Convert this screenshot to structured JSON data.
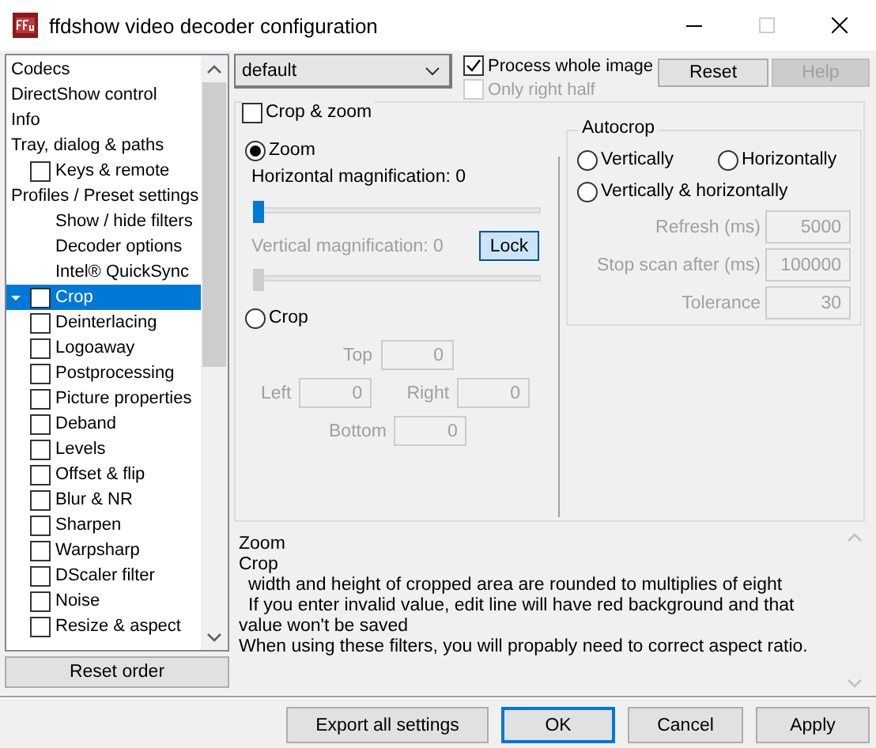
{
  "window": {
    "title": "ffdshow video decoder configuration"
  },
  "sidebar": {
    "items": [
      {
        "label": "Codecs",
        "selected": false
      },
      {
        "label": "DirectShow control",
        "selected": false
      },
      {
        "label": "Info",
        "selected": false
      },
      {
        "label": "Tray, dialog & paths",
        "selected": false,
        "children": [
          {
            "label": "Keys & remote",
            "kind": "checkbox",
            "checked": false,
            "selected": false
          }
        ]
      },
      {
        "label": "Profiles / Preset settings",
        "selected": false,
        "children": [
          {
            "label": "Show / hide filters",
            "kind": "plain",
            "selected": false
          },
          {
            "label": "Decoder options",
            "kind": "plain",
            "selected": false
          },
          {
            "label": "Intel® QuickSync",
            "kind": "plain",
            "selected": false
          },
          {
            "label": "Crop",
            "kind": "checkbox",
            "checked": false,
            "selected": true
          },
          {
            "label": "Deinterlacing",
            "kind": "checkbox",
            "checked": false,
            "selected": false
          },
          {
            "label": "Logoaway",
            "kind": "checkbox",
            "checked": false,
            "selected": false
          },
          {
            "label": "Postprocessing",
            "kind": "checkbox",
            "checked": false,
            "selected": false
          },
          {
            "label": "Picture properties",
            "kind": "checkbox",
            "checked": false,
            "selected": false
          },
          {
            "label": "Deband",
            "kind": "checkbox",
            "checked": false,
            "selected": false
          },
          {
            "label": "Levels",
            "kind": "checkbox",
            "checked": false,
            "selected": false
          },
          {
            "label": "Offset & flip",
            "kind": "checkbox",
            "checked": false,
            "selected": false
          },
          {
            "label": "Blur & NR",
            "kind": "checkbox",
            "checked": false,
            "selected": false
          },
          {
            "label": "Sharpen",
            "kind": "checkbox",
            "checked": false,
            "selected": false
          },
          {
            "label": "Warpsharp",
            "kind": "checkbox",
            "checked": false,
            "selected": false
          },
          {
            "label": "DScaler filter",
            "kind": "checkbox",
            "checked": false,
            "selected": false
          },
          {
            "label": "Noise",
            "kind": "checkbox",
            "checked": false,
            "selected": false
          },
          {
            "label": "Resize & aspect",
            "kind": "checkbox",
            "checked": false,
            "selected": false
          }
        ]
      }
    ]
  },
  "reset_order_button": "Reset order",
  "profile": {
    "value": "default"
  },
  "process_whole_image": {
    "label": "Process whole image",
    "checked": true,
    "disabled": false
  },
  "only_right_half": {
    "label": "Only right half",
    "checked": false,
    "disabled": true
  },
  "header_buttons": [
    {
      "label": "Reset",
      "disabled": false
    },
    {
      "label": "Help",
      "disabled": true
    }
  ],
  "crop_zoom": {
    "label": "Crop & zoom",
    "checked": false,
    "zoom": {
      "label": "Zoom",
      "selected": true
    },
    "horizontal": {
      "label": "Horizontal magnification: 0",
      "level": 0,
      "disabled": false
    },
    "vertical": {
      "label": "Vertical magnification: 0",
      "level": 0,
      "disabled": true
    },
    "lock_button": "Lock",
    "crop": {
      "label": "Crop",
      "selected": false
    },
    "crop_fields": [
      {
        "label": "Top",
        "value": "0",
        "disabled": true
      },
      {
        "label": "Left",
        "value": "0",
        "disabled": true
      },
      {
        "label": "Right",
        "value": "0",
        "disabled": true
      },
      {
        "label": "Bottom",
        "value": "0",
        "disabled": true
      }
    ],
    "autocrop": {
      "title": "Autocrop",
      "options": [
        {
          "label": "Vertically",
          "selected": false
        },
        {
          "label": "Horizontally",
          "selected": false
        },
        {
          "label": "Vertically & horizontally",
          "selected": false
        }
      ],
      "fields": [
        {
          "label": "Refresh (ms)",
          "value": "5000",
          "disabled": true
        },
        {
          "label": "Stop scan after (ms)",
          "value": "100000",
          "disabled": true
        },
        {
          "label": "Tolerance",
          "value": "30",
          "disabled": true
        }
      ]
    }
  },
  "description": [
    {
      "text": "Zoom",
      "indented": false
    },
    {
      "text": "Crop",
      "indented": false
    },
    {
      "text": "width and height of cropped area are rounded to multiplies of eight",
      "indented": true
    },
    {
      "text": "If you enter invalid value, edit line will have red background and that value won't be saved",
      "indented": true
    },
    {
      "text": "When using these filters, you will propably need to correct aspect ratio.",
      "indented": false
    }
  ],
  "footer_buttons": [
    {
      "label": "Export all settings",
      "default": false
    },
    {
      "label": "OK",
      "default": true
    },
    {
      "label": "Cancel",
      "default": false
    },
    {
      "label": "Apply",
      "default": false
    }
  ]
}
